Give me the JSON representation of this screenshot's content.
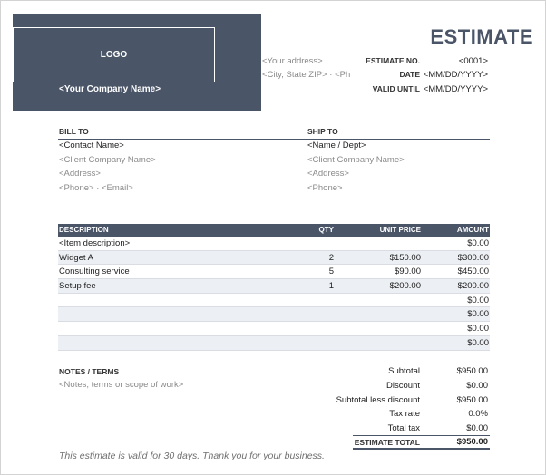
{
  "header": {
    "logo_label": "LOGO",
    "company_name": "<Your Company Name>",
    "address_line1": "<Your address>",
    "address_line2": "<City, State ZIP>  ·  <Ph",
    "title": "ESTIMATE",
    "brand_color": "#4a5568"
  },
  "meta": {
    "estimate_no_label": "ESTIMATE NO.",
    "estimate_no_value": "<0001>",
    "date_label": "DATE",
    "date_value": "<MM/DD/YYYY>",
    "valid_label": "VALID UNTIL",
    "valid_value": "<MM/DD/YYYY>"
  },
  "bill_to": {
    "title": "BILL TO",
    "lines": [
      "<Contact Name>",
      "<Client Company Name>",
      "<Address>",
      "<Phone>  ·  <Email>"
    ]
  },
  "ship_to": {
    "title": "SHIP TO",
    "lines": [
      "<Name / Dept>",
      "<Client Company Name>",
      "<Address>",
      "<Phone>"
    ]
  },
  "items": {
    "headers": {
      "desc": "DESCRIPTION",
      "qty": "QTY",
      "price": "UNIT PRICE",
      "amount": "AMOUNT"
    },
    "rows": [
      {
        "desc": "<Item description>",
        "qty": "",
        "price": "",
        "amount": "$0.00"
      },
      {
        "desc": "Widget A",
        "qty": "2",
        "price": "$150.00",
        "amount": "$300.00"
      },
      {
        "desc": "Consulting service",
        "qty": "5",
        "price": "$90.00",
        "amount": "$450.00"
      },
      {
        "desc": "Setup fee",
        "qty": "1",
        "price": "$200.00",
        "amount": "$200.00"
      },
      {
        "desc": "",
        "qty": "",
        "price": "",
        "amount": "$0.00"
      },
      {
        "desc": "",
        "qty": "",
        "price": "",
        "amount": "$0.00"
      },
      {
        "desc": "",
        "qty": "",
        "price": "",
        "amount": "$0.00"
      },
      {
        "desc": "",
        "qty": "",
        "price": "",
        "amount": "$0.00"
      }
    ]
  },
  "notes": {
    "title": "NOTES / TERMS",
    "text": "<Notes, terms or scope of work>"
  },
  "totals": {
    "subtotal_label": "Subtotal",
    "subtotal_value": "$950.00",
    "discount_label": "Discount",
    "discount_value": "$0.00",
    "less_discount_label": "Subtotal less discount",
    "less_discount_value": "$950.00",
    "tax_rate_label": "Tax rate",
    "tax_rate_value": "0.0%",
    "total_tax_label": "Total tax",
    "total_tax_value": "$0.00",
    "grand_label": "ESTIMATE TOTAL",
    "grand_value": "$950.00"
  },
  "footer": {
    "text": "This estimate is valid for 30 days.  Thank you for your business."
  }
}
